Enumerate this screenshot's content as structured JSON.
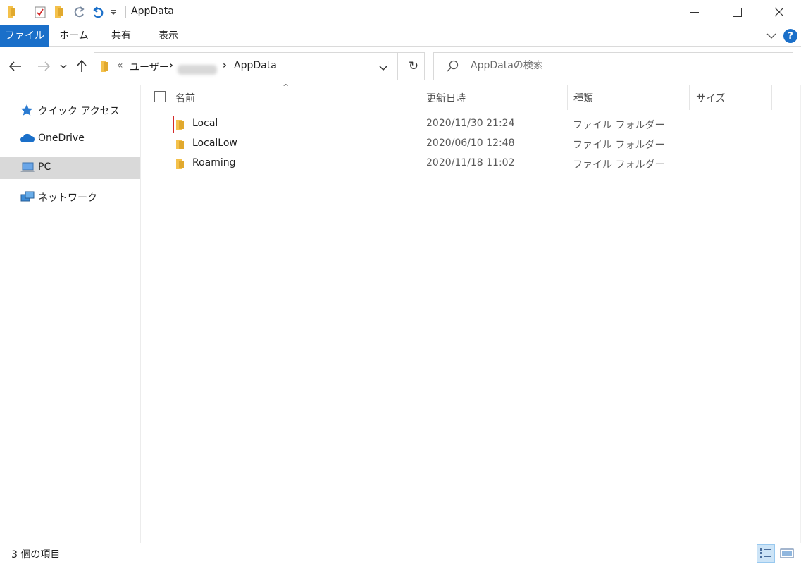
{
  "window": {
    "title": "AppData",
    "minimize_glyph": "—",
    "maximize_glyph": "☐",
    "close_glyph": "✕"
  },
  "ribbon": {
    "tabs": [
      "ファイル",
      "ホーム",
      "共有",
      "表示"
    ],
    "expand_glyph": "⌄",
    "help_glyph": "?"
  },
  "nav": {
    "back_glyph": "←",
    "forward_glyph": "→",
    "recent_glyph": "⌄",
    "up_glyph": "↑"
  },
  "address": {
    "overflow_glyph": "«",
    "crumbs": [
      "ユーザー",
      "AppData"
    ],
    "separator_glyph": "›",
    "dropdown_glyph": "⌄",
    "refresh_glyph": "↻"
  },
  "search": {
    "placeholder": "AppDataの検索"
  },
  "sidebar": {
    "items": [
      {
        "label": "クイック アクセス",
        "icon": "star-icon"
      },
      {
        "label": "OneDrive",
        "icon": "cloud-icon"
      },
      {
        "label": "PC",
        "icon": "computer-icon",
        "selected": true
      },
      {
        "label": "ネットワーク",
        "icon": "network-icon"
      }
    ]
  },
  "columns": {
    "name": "名前",
    "modified": "更新日時",
    "type": "種類",
    "size": "サイズ",
    "sort_glyph": "^"
  },
  "files": [
    {
      "name": "Local",
      "modified": "2020/11/30 21:24",
      "type": "ファイル フォルダー",
      "highlighted": true
    },
    {
      "name": "LocalLow",
      "modified": "2020/06/10 12:48",
      "type": "ファイル フォルダー"
    },
    {
      "name": "Roaming",
      "modified": "2020/11/18 11:02",
      "type": "ファイル フォルダー"
    }
  ],
  "status": {
    "item_count": "3 個の項目"
  },
  "colors": {
    "accent": "#1a6fc9",
    "folder": "#f4c14b",
    "highlight_border": "#d42a2a",
    "selected_nav": "#d9d9d9"
  }
}
